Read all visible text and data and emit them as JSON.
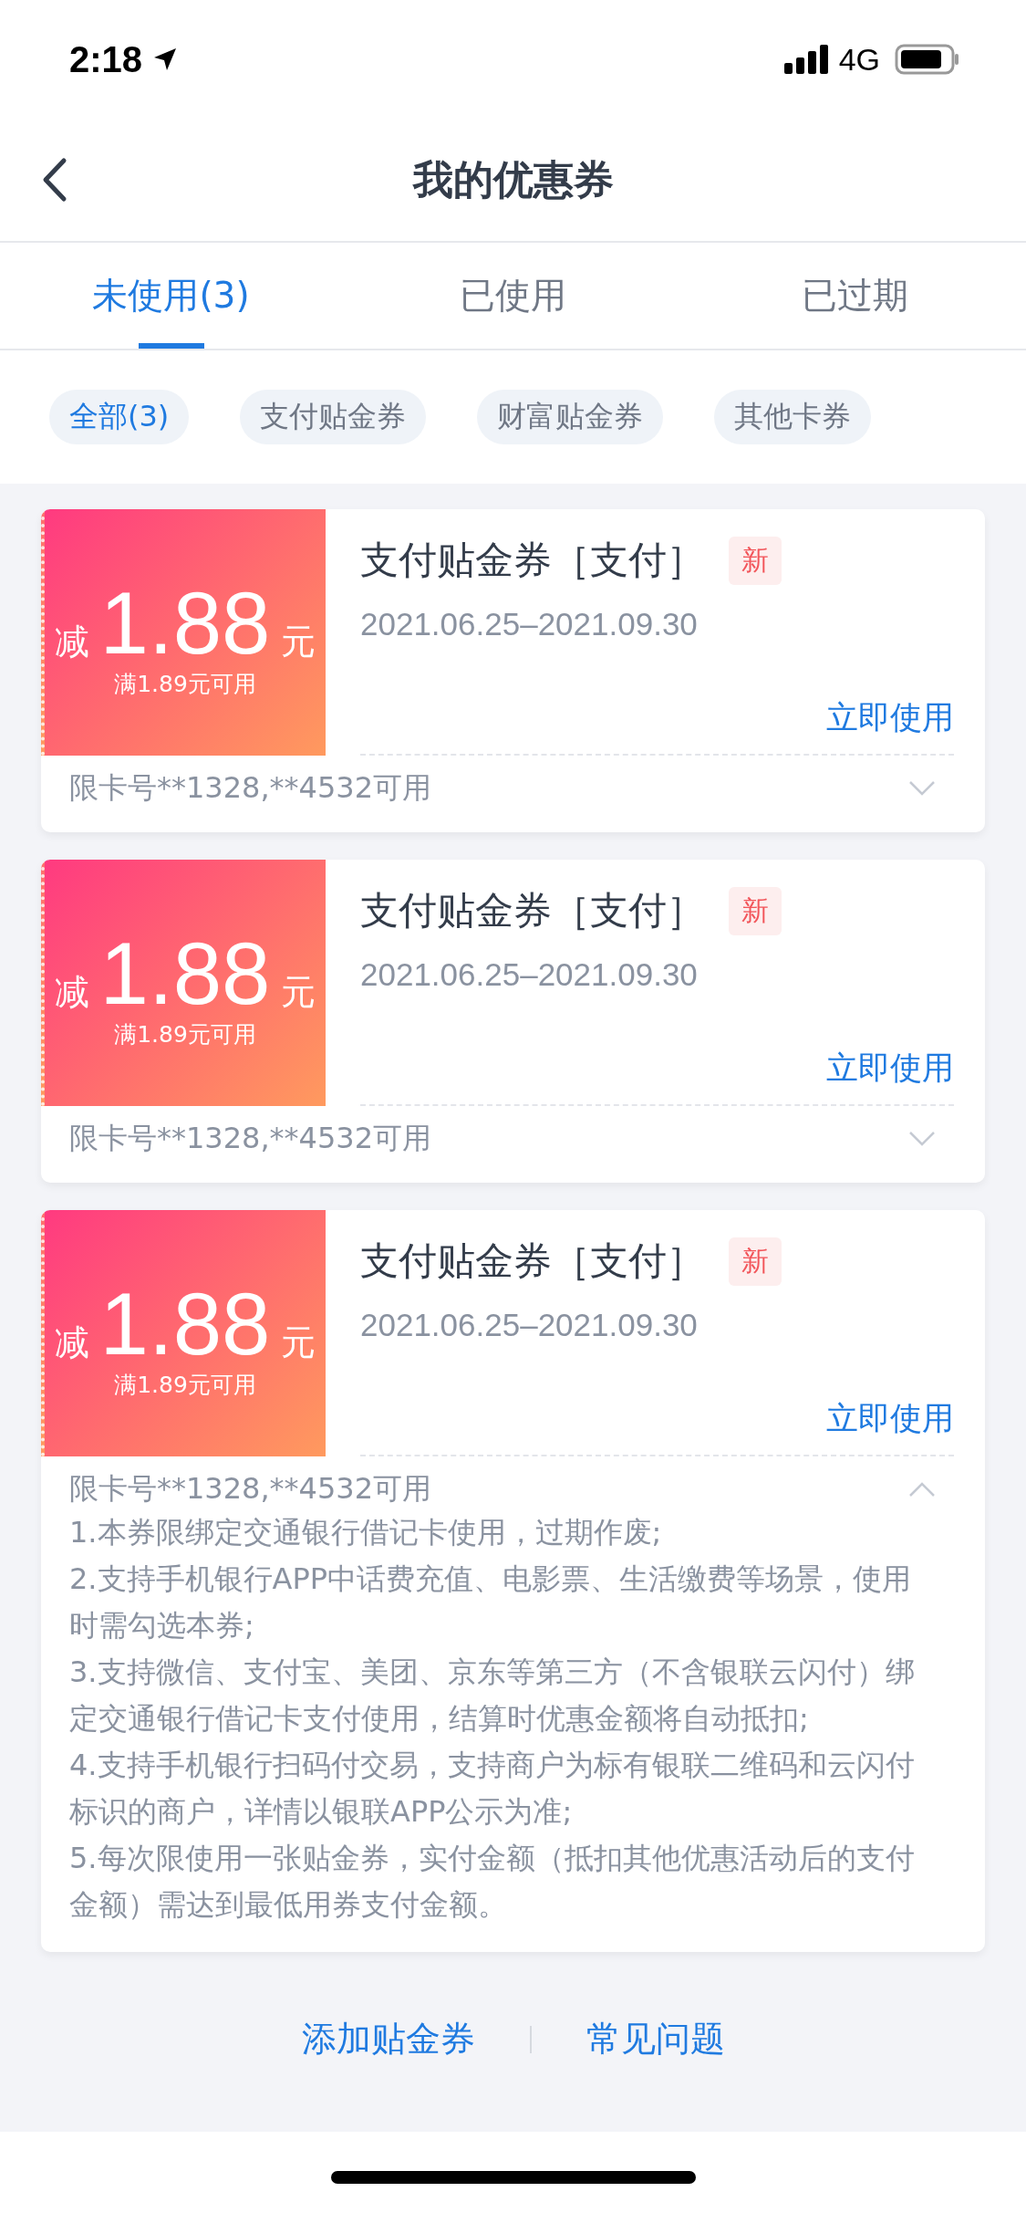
{
  "status_bar": {
    "time": "2:18",
    "network": "4G"
  },
  "nav": {
    "title": "我的优惠券"
  },
  "tabs": [
    {
      "label": "未使用(3)",
      "selected": true
    },
    {
      "label": "已使用",
      "selected": false
    },
    {
      "label": "已过期",
      "selected": false
    }
  ],
  "filters": [
    {
      "label": "全部(3)",
      "selected": true
    },
    {
      "label": "支付贴金券",
      "selected": false
    },
    {
      "label": "财富贴金券",
      "selected": false
    },
    {
      "label": "其他卡券",
      "selected": false
    }
  ],
  "coupons": [
    {
      "prefix": "减",
      "amount": "1.88",
      "unit": "元",
      "condition": "满1.89元可用",
      "title": "支付贴金券［支付］",
      "badge": "新",
      "validity": "2021.06.25–2021.09.30",
      "action": "立即使用",
      "card_limit": "限卡号**1328,**4532可用",
      "expanded": false
    },
    {
      "prefix": "减",
      "amount": "1.88",
      "unit": "元",
      "condition": "满1.89元可用",
      "title": "支付贴金券［支付］",
      "badge": "新",
      "validity": "2021.06.25–2021.09.30",
      "action": "立即使用",
      "card_limit": "限卡号**1328,**4532可用",
      "expanded": false
    },
    {
      "prefix": "减",
      "amount": "1.88",
      "unit": "元",
      "condition": "满1.89元可用",
      "title": "支付贴金券［支付］",
      "badge": "新",
      "validity": "2021.06.25–2021.09.30",
      "action": "立即使用",
      "card_limit": "限卡号**1328,**4532可用",
      "expanded": true,
      "rules": [
        "1.本券限绑定交通银行借记卡使用，过期作废;",
        "2.支持手机银行APP中话费充值、电影票、生活缴费等场景，使用时需勾选本券;",
        "3.支持微信、支付宝、美团、京东等第三方（不含银联云闪付）绑定交通银行借记卡支付使用，结算时优惠金额将自动抵扣;",
        "4.支持手机银行扫码付交易，支持商户为标有银联二维码和云闪付标识的商户，详情以银联APP公示为准;",
        "5.每次限使用一张贴金券，实付金额（抵扣其他优惠活动后的支付金额）需达到最低用券支付金额。"
      ]
    }
  ],
  "footer_links": [
    "添加贴金券",
    "常见问题"
  ]
}
